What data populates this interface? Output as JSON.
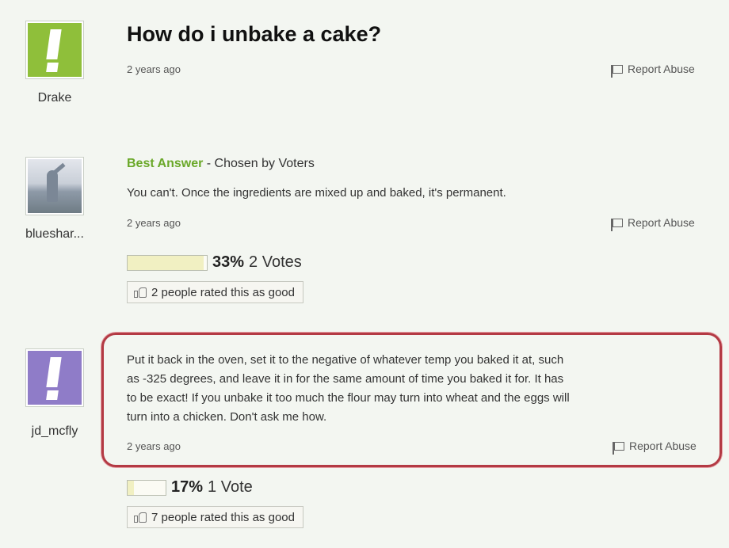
{
  "question": {
    "title": "How do i unbake a cake?",
    "asker": "Drake",
    "time": "2 years ago",
    "report_label": "Report Abuse"
  },
  "best_answer": {
    "label": "Best Answer",
    "chosen_by": "- Chosen by Voters",
    "author": "blueshar...",
    "text": "You can't. Once the ingredients are mixed up and baked, it's permanent.",
    "time": "2 years ago",
    "report_label": "Report Abuse",
    "vote_percent": "33%",
    "vote_fraction": 0.33,
    "votes_label": "2 Votes",
    "rated_label": "2 people rated this as good"
  },
  "second_answer": {
    "author": "jd_mcfly",
    "text_lines": [
      "Put it back in the oven, set it to the negative of whatever temp you baked it at, such",
      "as -325 degrees, and leave it in for the same amount of time you baked it for. It has",
      "to be exact! If you unbake it too much the flour may turn into wheat and the eggs will",
      "turn into a chicken. Don't ask me how."
    ],
    "time": "2 years ago",
    "report_label": "Report Abuse",
    "vote_percent": "17%",
    "vote_fraction": 0.17,
    "votes_label": "1 Vote",
    "rated_label": "7 people rated this as good"
  },
  "colors": {
    "background": "#f3f6f1",
    "best_answer_green": "#6aa829",
    "highlight_red": "#b33a44",
    "avatar_green": "#8fbf3a",
    "avatar_purple": "#8f7cc8"
  },
  "icons": [
    "flag-icon",
    "thumbs-up-icon"
  ]
}
